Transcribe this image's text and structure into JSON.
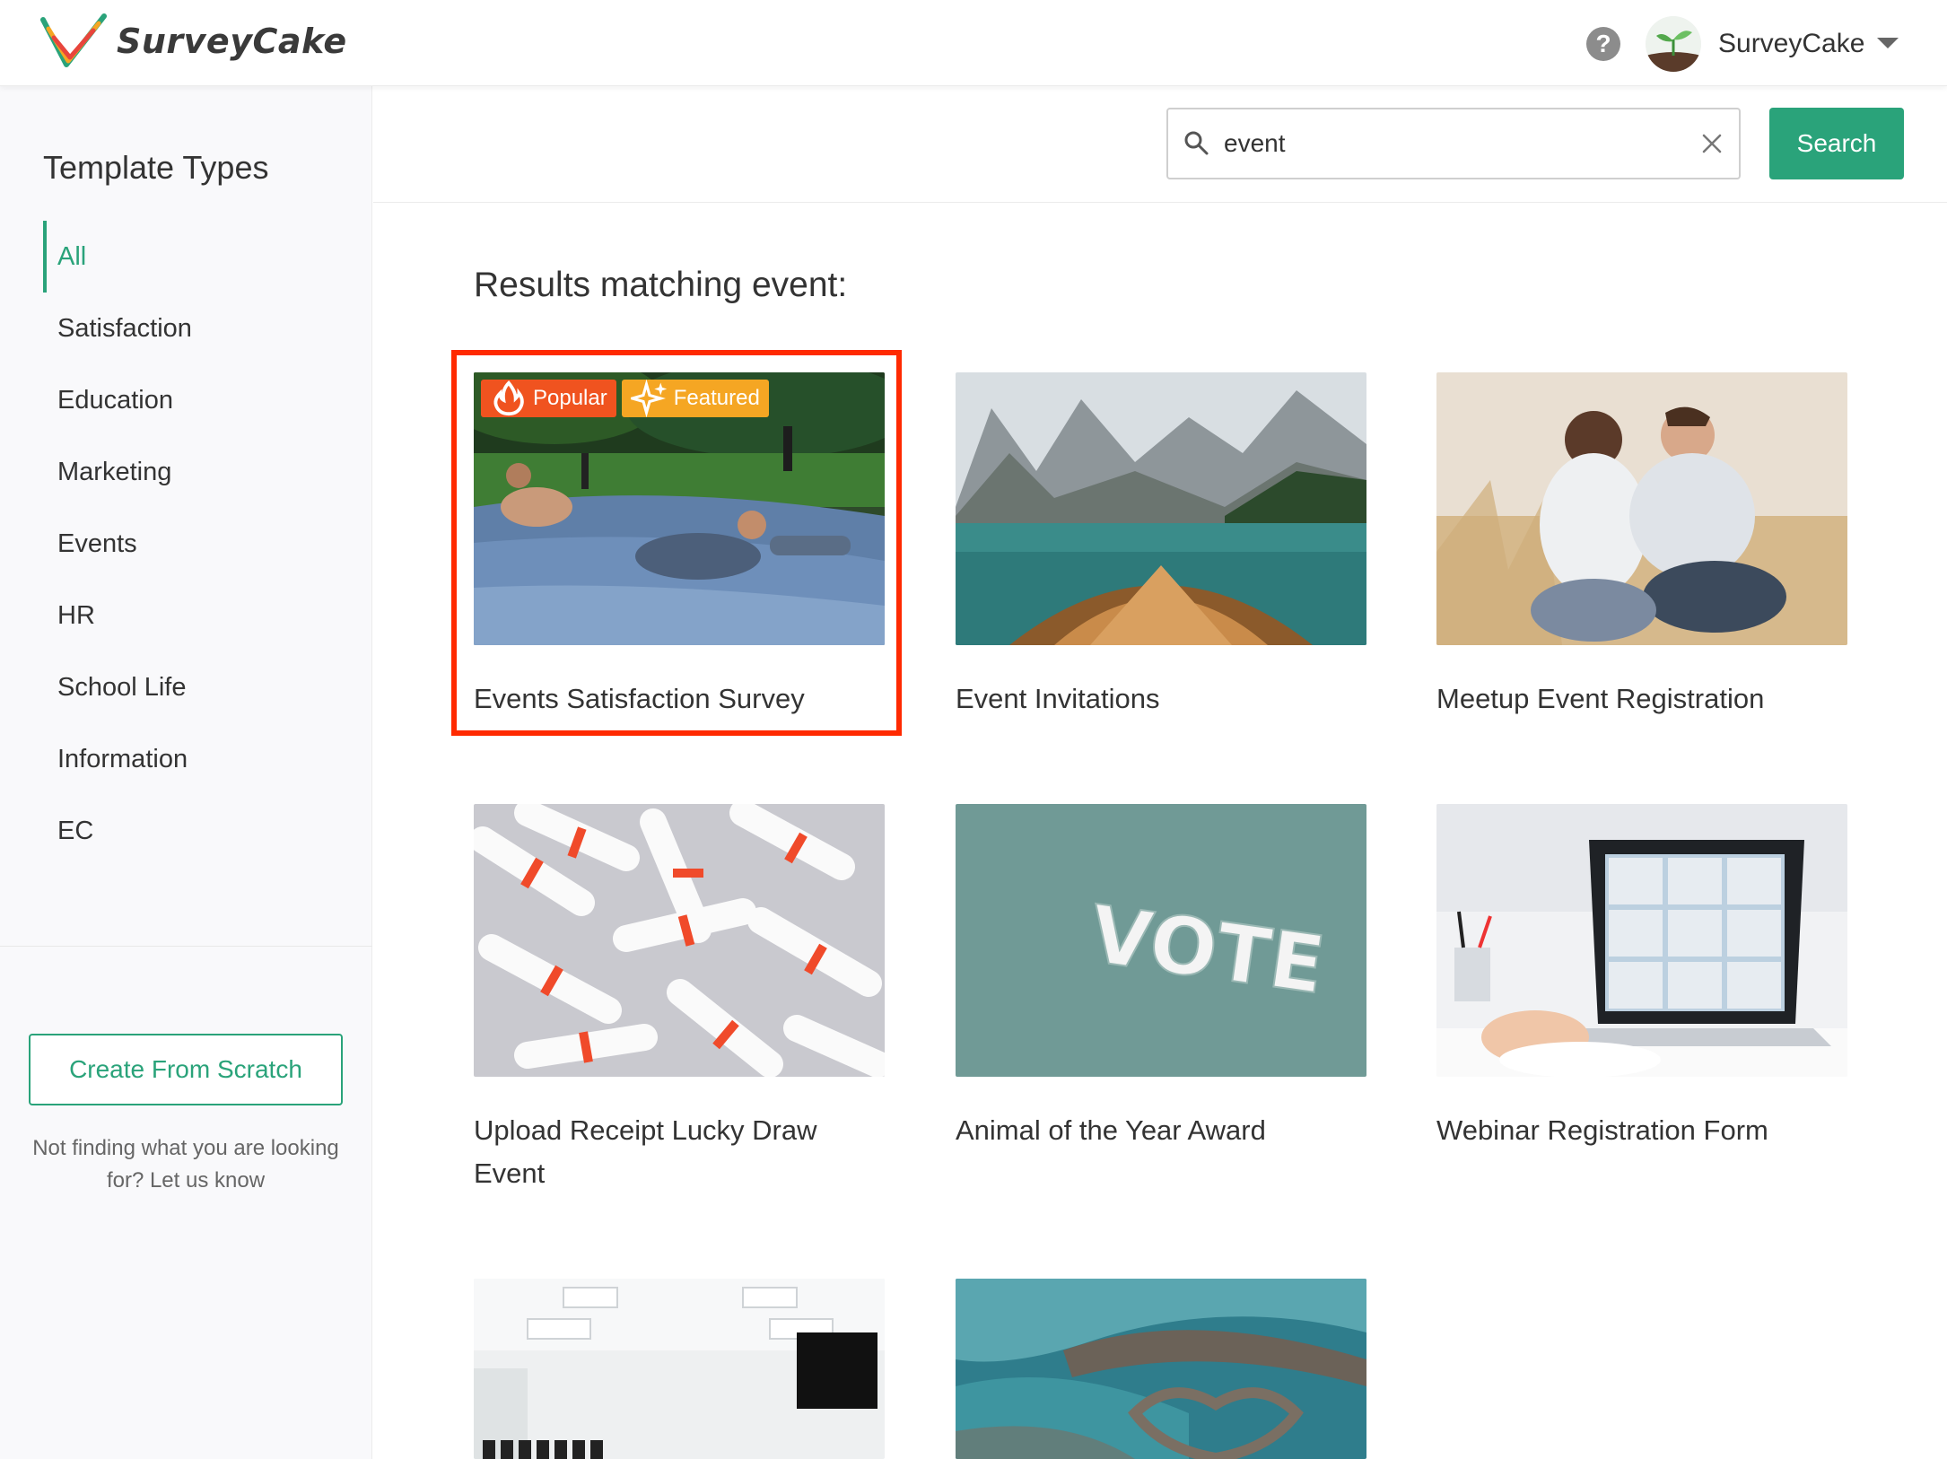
{
  "header": {
    "logo_text": "SurveyCake",
    "user_name": "SurveyCake"
  },
  "sidebar": {
    "title": "Template Types",
    "types": [
      "All",
      "Satisfaction",
      "Education",
      "Marketing",
      "Events",
      "HR",
      "School Life",
      "Information",
      "EC"
    ],
    "active_type": "All",
    "create_button": "Create From Scratch",
    "help_text": "Not finding what you are looking for? Let us know"
  },
  "search": {
    "value": "event",
    "button_label": "Search"
  },
  "results": {
    "title": "Results matching event:",
    "badges": {
      "popular": "Popular",
      "featured": "Featured"
    },
    "cards": [
      {
        "title": "Events Satisfaction Survey",
        "image": "slip-and-slide-photo",
        "badges": [
          "Popular",
          "Featured"
        ],
        "highlighted": true
      },
      {
        "title": "Event Invitations",
        "image": "lake-boat-photo"
      },
      {
        "title": "Meetup Event Registration",
        "image": "couple-photo"
      },
      {
        "title": "Upload Receipt Lucky Draw Event",
        "image": "rolled-tickets-photo"
      },
      {
        "title": "Animal of the Year Award",
        "image": "vote-photo",
        "image_text": "VOTE"
      },
      {
        "title": "Webinar Registration Form",
        "image": "webinar-laptop-photo"
      },
      {
        "title": "",
        "image": "meeting-room-photo"
      },
      {
        "title": "",
        "image": "heart-stone-weir-photo"
      }
    ]
  },
  "colors": {
    "accent": "#2aa37a",
    "highlight_border": "#ff2a00",
    "popular_badge": "#f0531f",
    "featured_badge": "#f5a623"
  }
}
